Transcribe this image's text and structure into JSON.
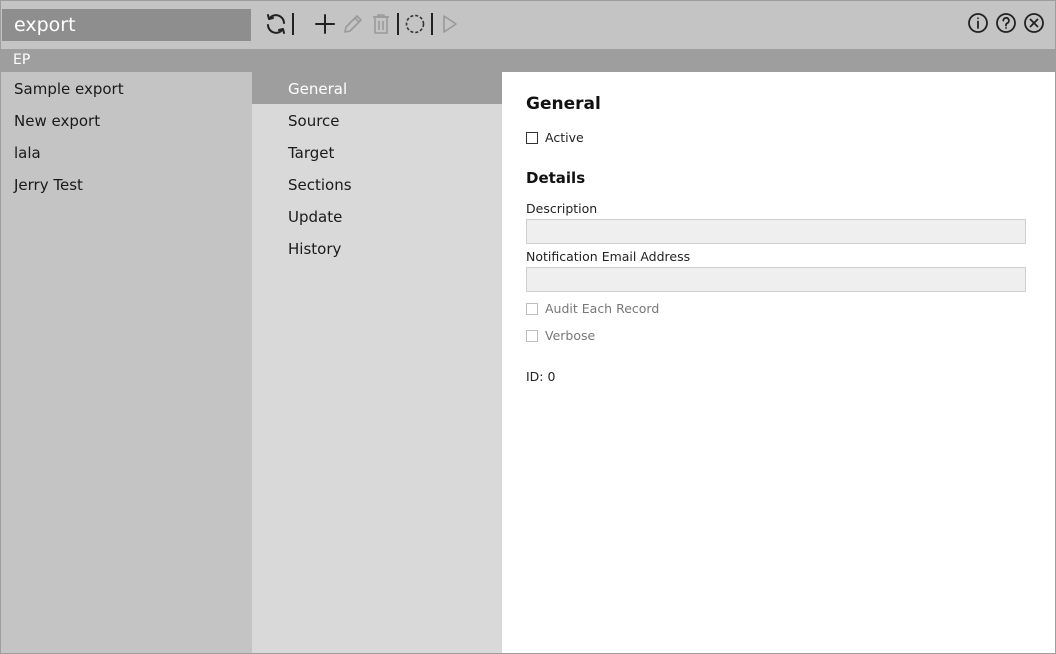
{
  "header": {
    "title": "export"
  },
  "toolbar": {
    "icons": [
      "refresh-icon",
      "add-icon",
      "edit-icon",
      "delete-icon",
      "spinner-icon",
      "run-icon",
      "info-icon",
      "help-icon",
      "close-icon"
    ]
  },
  "group": {
    "label": "EP"
  },
  "exports": [
    {
      "label": "Sample export"
    },
    {
      "label": "New export"
    },
    {
      "label": "lala"
    },
    {
      "label": "Jerry Test"
    }
  ],
  "nav": [
    {
      "label": "General",
      "active": true
    },
    {
      "label": "Source"
    },
    {
      "label": "Target"
    },
    {
      "label": "Sections"
    },
    {
      "label": "Update"
    },
    {
      "label": "History"
    }
  ],
  "content": {
    "heading": "General",
    "active_label": "Active",
    "details_heading": "Details",
    "description_label": "Description",
    "description_value": "",
    "email_label": "Notification Email Address",
    "email_value": "",
    "audit_label": "Audit Each Record",
    "verbose_label": "Verbose",
    "id_text": "ID: 0"
  },
  "colors": {
    "toolbar_bg": "#c4c4c4",
    "title_bg": "#8e8e8e",
    "group_bg": "#9e9e9e",
    "nav_active_bg": "#9e9e9e"
  }
}
